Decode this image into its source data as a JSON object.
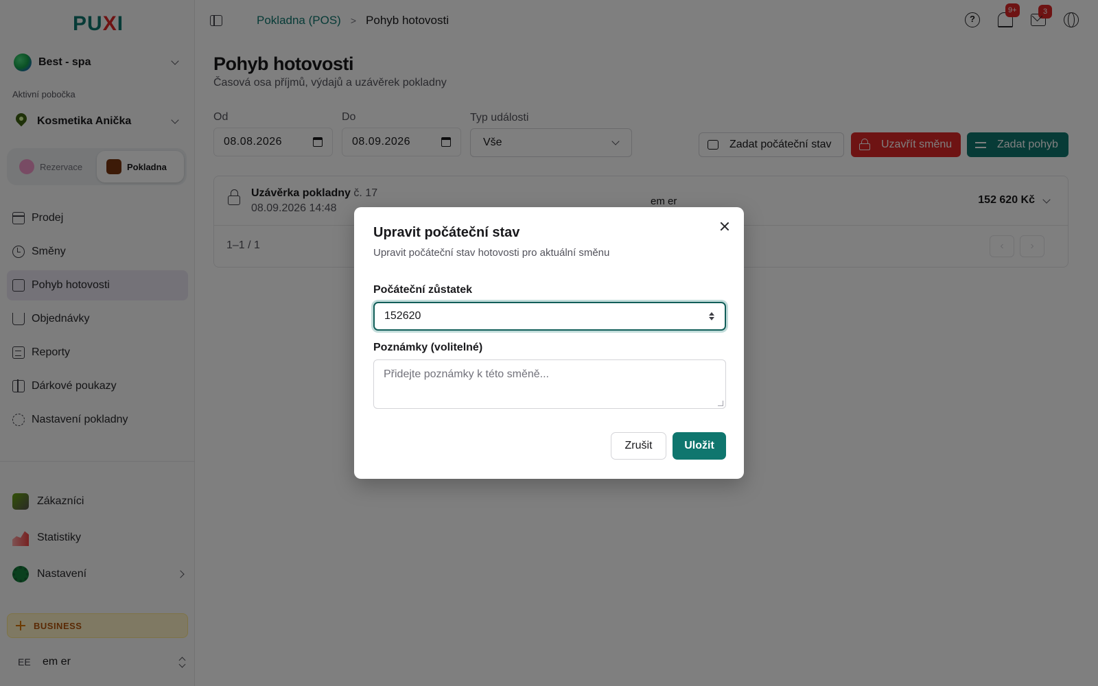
{
  "app": {
    "logo_text": "PUXI"
  },
  "sidebar": {
    "org_name": "Best - spa",
    "branch_caption": "Aktivní pobočka",
    "branch_name": "Kosmetika Anička",
    "modes": [
      {
        "label": "Rezervace"
      },
      {
        "label": "Pokladna"
      }
    ],
    "nav": [
      {
        "label": "Prodej",
        "icon": "credit-card-icon"
      },
      {
        "label": "Směny",
        "icon": "clock-icon"
      },
      {
        "label": "Pohyb hotovosti",
        "icon": "wallet-icon",
        "active": true
      },
      {
        "label": "Objednávky",
        "icon": "cart-icon"
      },
      {
        "label": "Reporty",
        "icon": "document-icon"
      },
      {
        "label": "Dárkové poukazy",
        "icon": "gift-icon"
      },
      {
        "label": "Nastavení pokladny",
        "icon": "gear-icon"
      }
    ],
    "nav2": [
      {
        "label": "Zákazníci"
      },
      {
        "label": "Statistiky"
      },
      {
        "label": "Nastavení"
      }
    ],
    "plan": "BUSINESS",
    "user_initials": "EE",
    "user_name": "em er"
  },
  "header": {
    "breadcrumb_parent": "Pokladna (POS)",
    "breadcrumb_sep": ">",
    "breadcrumb_current": "Pohyb hotovosti",
    "notifications_badge": "9+",
    "messages_badge": "3",
    "help_glyph": "?"
  },
  "main": {
    "title": "Pohyb hotovosti",
    "subtitle": "Časová osa příjmů, výdajů a uzávěrek pokladny",
    "filters": {
      "from_label": "Od",
      "from_value": "08.08.2026",
      "to_label": "Do",
      "to_value": "08.09.2026",
      "type_label": "Typ události",
      "type_value": "Vše"
    },
    "actions": {
      "opening": "Zadat počáteční stav",
      "close_shift": "Uzavřít směnu",
      "movement": "Zadat pohyb"
    },
    "entry": {
      "title": "Uzávěrka pokladny",
      "number": "č. 17",
      "date": "08.09.2026 14:48",
      "user": "em er",
      "amount": "152 620 Kč"
    },
    "pager": {
      "info": "1–1 / 1",
      "prev": "‹",
      "next": "›"
    }
  },
  "modal": {
    "title": "Upravit počáteční stav",
    "description": "Upravit počáteční stav hotovosti pro aktuální směnu",
    "balance_label": "Počáteční zůstatek",
    "balance_value": "152620",
    "notes_label": "Poznámky (volitelné)",
    "notes_placeholder": "Přidejte poznámky k této směně...",
    "cancel": "Zrušit",
    "save": "Uložit"
  },
  "colors": {
    "primary": "#0f766e",
    "danger": "#dc2626",
    "plan_badge": "#fef3c7"
  }
}
